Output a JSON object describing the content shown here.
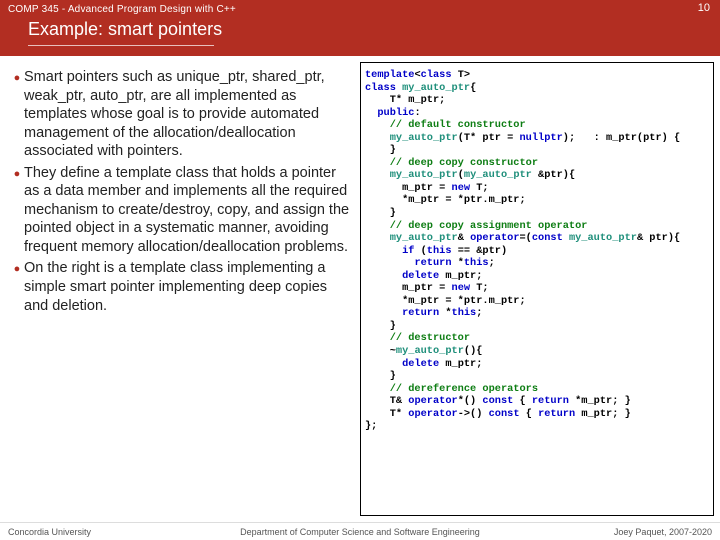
{
  "header": {
    "course": "COMP 345 - Advanced Program Design with C++",
    "page_num": "10",
    "title": "Example: smart pointers"
  },
  "bullets": [
    "Smart pointers such as unique_ptr, shared_ptr, weak_ptr, auto_ptr, are all implemented as templates whose goal is to provide automated management of the allocation/deallocation associated with pointers.",
    "They define a template class that holds a pointer as a data member and implements all the required mechanism to create/destroy, copy, and assign the pointed object in a systematic manner, avoiding frequent memory allocation/deallocation problems.",
    "On the right is a template class implementing a simple smart pointer implementing deep copies and deletion."
  ],
  "code": {
    "l01a": "template",
    "l01b": "<",
    "l01c": "class",
    "l01d": " T>",
    "l02a": "class",
    "l02b": " ",
    "l02c": "my_auto_ptr",
    "l02d": "{",
    "l03": "    T* m_ptr;",
    "l04a": "  ",
    "l04b": "public",
    "l04c": ":",
    "l05": "    // default constructor",
    "l06a": "    ",
    "l06b": "my_auto_ptr",
    "l06c": "(T* ptr = ",
    "l06d": "nullptr",
    "l06e": ");   : m_ptr(ptr) {",
    "l07": "    }",
    "l08": "    // deep copy constructor",
    "l09a": "    ",
    "l09b": "my_auto_ptr",
    "l09c": "(",
    "l09d": "my_auto_ptr",
    "l09e": " &ptr){",
    "l10a": "      m_ptr = ",
    "l10b": "new",
    "l10c": " T;",
    "l11": "      *m_ptr = *ptr.m_ptr;",
    "l12": "    }",
    "l13": "    // deep copy assignment operator",
    "l14a": "    ",
    "l14b": "my_auto_ptr",
    "l14c": "& ",
    "l14d": "operator",
    "l14e": "=(",
    "l14f": "const",
    "l14g": " ",
    "l14h": "my_auto_ptr",
    "l14i": "& ptr){",
    "l15a": "      ",
    "l15b": "if",
    "l15c": " (",
    "l15d": "this",
    "l15e": " == &ptr)",
    "l16a": "        ",
    "l16b": "return",
    "l16c": " *",
    "l16d": "this",
    "l16e": ";",
    "l17a": "      ",
    "l17b": "delete",
    "l17c": " m_ptr;",
    "l18a": "      m_ptr = ",
    "l18b": "new",
    "l18c": " T;",
    "l19": "      *m_ptr = *ptr.m_ptr;",
    "l20a": "      ",
    "l20b": "return",
    "l20c": " *",
    "l20d": "this",
    "l20e": ";",
    "l21": "    }",
    "l22": "    // destructor",
    "l23a": "    ~",
    "l23b": "my_auto_ptr",
    "l23c": "(){",
    "l24a": "      ",
    "l24b": "delete",
    "l24c": " m_ptr;",
    "l25": "    }",
    "l26": "    // dereference operators",
    "l27a": "    T& ",
    "l27b": "operator",
    "l27c": "*() ",
    "l27d": "const",
    "l27e": " { ",
    "l27f": "return",
    "l27g": " *m_ptr; }",
    "l28a": "    T* ",
    "l28b": "operator",
    "l28c": "->() ",
    "l28d": "const",
    "l28e": " { ",
    "l28f": "return",
    "l28g": " m_ptr; }",
    "l29": "};"
  },
  "footer": {
    "left": "Concordia University",
    "center": "Department of Computer Science and Software Engineering",
    "right": "Joey Paquet, 2007-2020"
  }
}
